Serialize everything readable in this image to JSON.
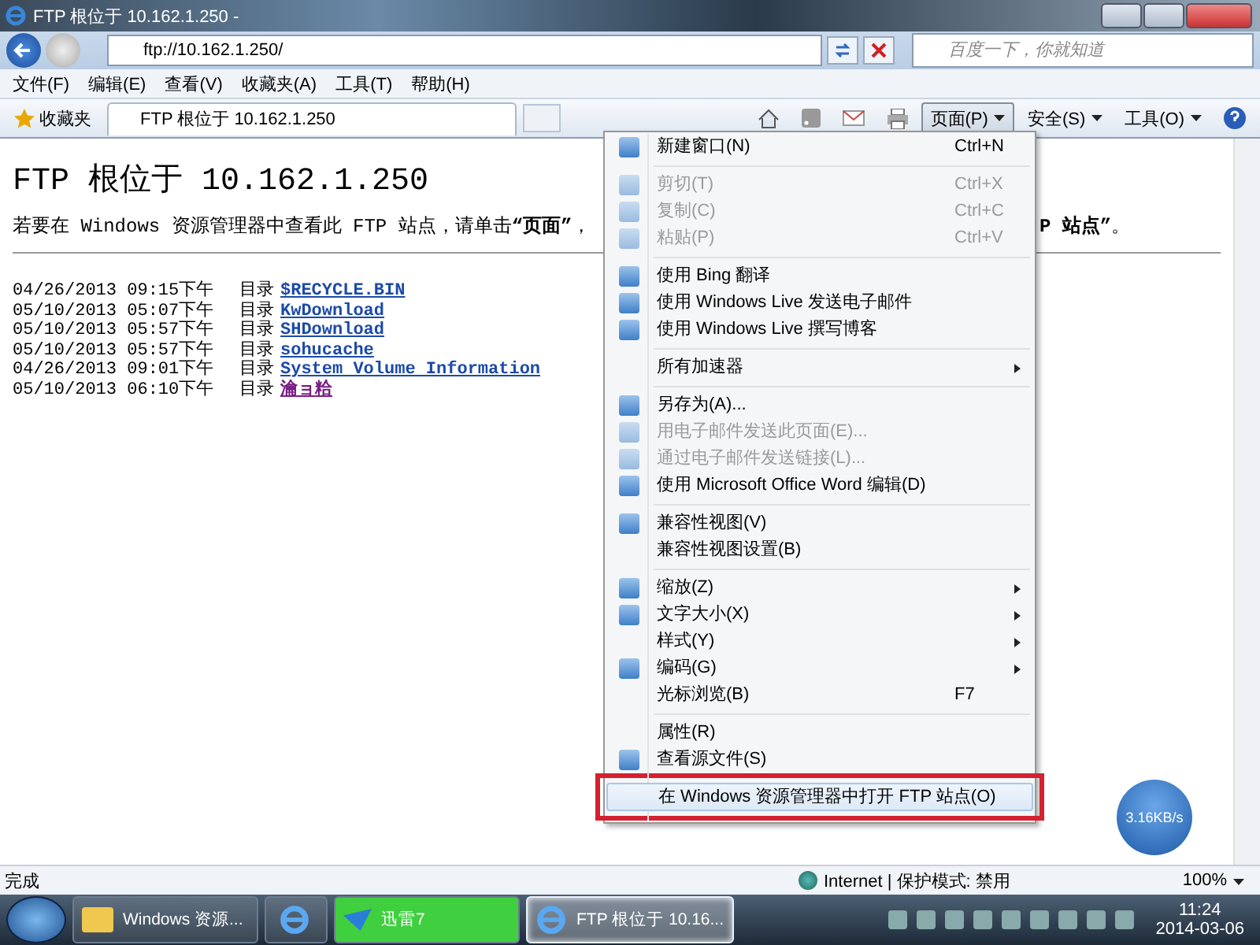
{
  "window": {
    "title": "FTP 根位于 10.162.1.250 -"
  },
  "address_bar": {
    "value": "ftp://10.162.1.250/"
  },
  "search": {
    "placeholder": "百度一下，你就知道"
  },
  "menu_bar": [
    "文件(F)",
    "编辑(E)",
    "查看(V)",
    "收藏夹(A)",
    "工具(T)",
    "帮助(H)"
  ],
  "favorites": {
    "label": "收藏夹"
  },
  "tabs": [
    {
      "label": "FTP 根位于 10.162.1.250",
      "selected": true
    }
  ],
  "command_bar": [
    {
      "kind": "home"
    },
    {
      "kind": "feeds"
    },
    {
      "kind": "mail"
    },
    {
      "kind": "print"
    },
    {
      "kind": "text",
      "label": "页面(P)",
      "selected": true
    },
    {
      "kind": "text",
      "label": "安全(S)",
      "selected": false
    },
    {
      "kind": "text",
      "label": "工具(O)",
      "selected": false
    },
    {
      "kind": "help"
    }
  ],
  "page": {
    "heading": "FTP 根位于 10.162.1.250",
    "instruction_left": "若要在 Windows 资源管理器中查看此 FTP 站点，请单击**“页面”**，",
    "instruction_right": "**P 站点”**。",
    "listing": [
      {
        "date": "04/26/2013 09:15下午",
        "type": "目录",
        "name": "$RECYCLE.BIN",
        "visited": false
      },
      {
        "date": "05/10/2013 05:07下午",
        "type": "目录",
        "name": "KwDownload",
        "visited": false
      },
      {
        "date": "05/10/2013 05:57下午",
        "type": "目录",
        "name": "SHDownload",
        "visited": false
      },
      {
        "date": "05/10/2013 05:57下午",
        "type": "目录",
        "name": "sohucache",
        "visited": false
      },
      {
        "date": "04/26/2013 09:01下午",
        "type": "目录",
        "name": "System Volume Information",
        "visited": false
      },
      {
        "date": "05/10/2013 06:10下午",
        "type": "目录",
        "name": "瀹ョ粭",
        "visited": true
      }
    ]
  },
  "context_menu": [
    {
      "kind": "item",
      "label": "新建窗口(N)",
      "shortcut": "Ctrl+N",
      "disabled": false,
      "icon": true
    },
    {
      "kind": "separator"
    },
    {
      "kind": "item",
      "label": "剪切(T)",
      "shortcut": "Ctrl+X",
      "disabled": true,
      "icon": true
    },
    {
      "kind": "item",
      "label": "复制(C)",
      "shortcut": "Ctrl+C",
      "disabled": true,
      "icon": true
    },
    {
      "kind": "item",
      "label": "粘贴(P)",
      "shortcut": "Ctrl+V",
      "disabled": true,
      "icon": true
    },
    {
      "kind": "separator"
    },
    {
      "kind": "item",
      "label": "使用 Bing 翻译",
      "disabled": false,
      "icon": true
    },
    {
      "kind": "item",
      "label": "使用 Windows Live 发送电子邮件",
      "disabled": false,
      "icon": true
    },
    {
      "kind": "item",
      "label": "使用 Windows Live 撰写博客",
      "disabled": false,
      "icon": true
    },
    {
      "kind": "separator"
    },
    {
      "kind": "item",
      "label": "所有加速器",
      "disabled": false,
      "submenu": true
    },
    {
      "kind": "separator"
    },
    {
      "kind": "item",
      "label": "另存为(A)...",
      "disabled": false,
      "icon": true
    },
    {
      "kind": "item",
      "label": "用电子邮件发送此页面(E)...",
      "disabled": true,
      "icon": true
    },
    {
      "kind": "item",
      "label": "通过电子邮件发送链接(L)...",
      "disabled": true,
      "icon": true
    },
    {
      "kind": "item",
      "label": "使用 Microsoft Office Word 编辑(D)",
      "disabled": false,
      "icon": true
    },
    {
      "kind": "separator"
    },
    {
      "kind": "item",
      "label": "兼容性视图(V)",
      "disabled": false,
      "icon": true
    },
    {
      "kind": "item",
      "label": "兼容性视图设置(B)",
      "disabled": false
    },
    {
      "kind": "separator"
    },
    {
      "kind": "item",
      "label": "缩放(Z)",
      "disabled": false,
      "icon": true,
      "submenu": true
    },
    {
      "kind": "item",
      "label": "文字大小(X)",
      "disabled": false,
      "icon": true,
      "submenu": true
    },
    {
      "kind": "item",
      "label": "样式(Y)",
      "disabled": false,
      "submenu": true
    },
    {
      "kind": "item",
      "label": "编码(G)",
      "disabled": false,
      "icon": true,
      "submenu": true
    },
    {
      "kind": "item",
      "label": "光标浏览(B)",
      "shortcut": "F7",
      "disabled": false
    },
    {
      "kind": "separator"
    },
    {
      "kind": "item",
      "label": "属性(R)",
      "disabled": false
    },
    {
      "kind": "item",
      "label": "查看源文件(S)",
      "disabled": false,
      "icon": true
    },
    {
      "kind": "item",
      "label": "在 Windows 资源管理器中打开 FTP 站点(O)",
      "disabled": false,
      "selected": true,
      "annotated": true
    }
  ],
  "speed_widget": {
    "reading": "3.16KB/s"
  },
  "status_bar": {
    "text": "完成",
    "zone": "Internet | 保护模式: 禁用",
    "zoom": "100%"
  },
  "taskbar": {
    "buttons": [
      {
        "kind": "explorer",
        "label": "Windows 资源...",
        "selected": false
      },
      {
        "kind": "ie-pin",
        "selected": false
      },
      {
        "kind": "thunder",
        "label": "迅雷7",
        "selected": false,
        "color": "#3fcf3f"
      },
      {
        "kind": "ie",
        "label": "FTP 根位于 10.16...",
        "selected": true
      }
    ],
    "time": "11:24",
    "date": "2014-03-06"
  }
}
